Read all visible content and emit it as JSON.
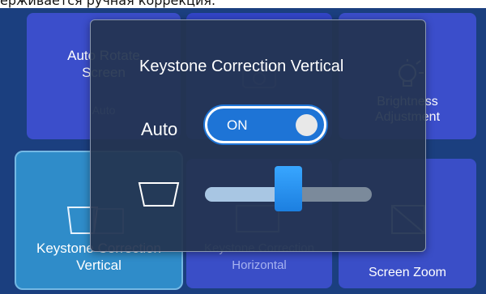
{
  "caption": "ерживается ручная коррекция.",
  "background_tiles": {
    "auto_rotate": {
      "label": "Auto Rotate Screen",
      "sub": "Auto"
    },
    "brightness": {
      "label": "Brightness Adjustment"
    },
    "keystone_vertical": {
      "label": "Keystone Correction Vertical"
    },
    "keystone_horizontal": {
      "label": "Keystone Correction Horizontal"
    },
    "screen_zoom": {
      "label": "Screen Zoom"
    }
  },
  "dialog": {
    "title": "Keystone Correction Vertical",
    "auto_label": "Auto",
    "toggle_label": "ON",
    "toggle_on": true,
    "slider_value_fraction": 0.5
  },
  "colors": {
    "accent": "#1e74d6",
    "dialog_bg": "#243450",
    "tile_selected": "#2f8cc9"
  }
}
